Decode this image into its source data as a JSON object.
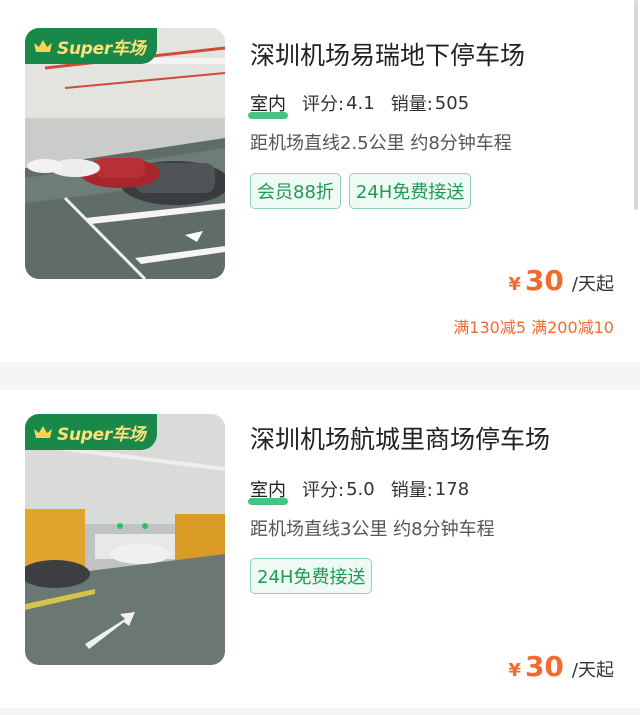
{
  "listings": [
    {
      "badge": "Super车场",
      "title": "深圳机场易瑞地下停车场",
      "type": "室内",
      "rating_label": "评分:",
      "rating": "4.1",
      "sales_label": "销量:",
      "sales": "505",
      "distance": "距机场直线2.5公里 约8分钟车程",
      "tags": [
        "会员88折",
        "24H免费接送"
      ],
      "currency": "¥",
      "price": "30",
      "price_unit": "/天起",
      "promo": "满130减5 满200减10"
    },
    {
      "badge": "Super车场",
      "title": "深圳机场航城里商场停车场",
      "type": "室内",
      "rating_label": "评分:",
      "rating": "5.0",
      "sales_label": "销量:",
      "sales": "178",
      "distance": "距机场直线3公里 约8分钟车程",
      "tags": [
        "24H免费接送"
      ],
      "currency": "¥",
      "price": "30",
      "price_unit": "/天起"
    }
  ],
  "colors": {
    "accent_green": "#19894a",
    "tag_green": "#1e9a57",
    "price_orange": "#f26b2e",
    "badge_gold": "#ffe07a"
  }
}
